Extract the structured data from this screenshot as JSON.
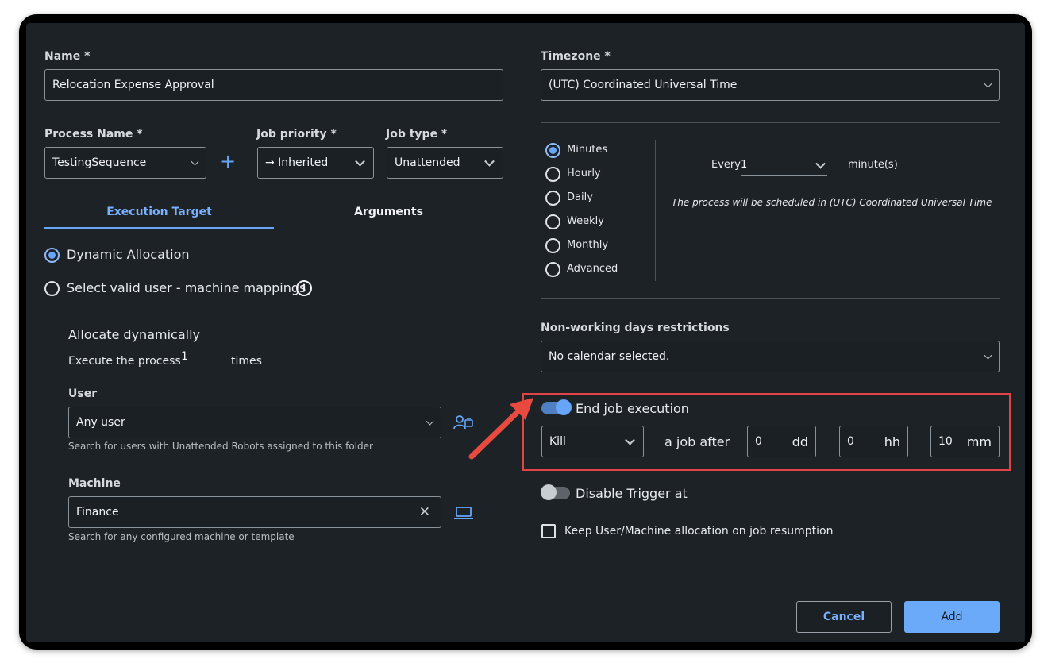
{
  "form": {
    "name_label": "Name *",
    "name_value": "Relocation Expense Approval",
    "process_label": "Process Name *",
    "process_value": "TestingSequence",
    "add_process": "+",
    "priority_label": "Job priority *",
    "priority_value": "→ Inherited",
    "jobtype_label": "Job type *",
    "jobtype_value": "Unattended"
  },
  "tabs": [
    {
      "label": "Execution Target",
      "active": true
    },
    {
      "label": "Arguments",
      "active": false
    }
  ],
  "allocation": {
    "dynamic_label": "Dynamic Allocation",
    "mapping_label": "Select valid user - machine mappings",
    "section_title": "Allocate dynamically",
    "execute_prefix": "Execute the process",
    "execute_count": "1",
    "execute_suffix": "times",
    "user_label": "User",
    "user_value": "Any user",
    "user_hint": "Search for users with Unattended Robots assigned to this folder",
    "machine_label": "Machine",
    "machine_value": "Finance",
    "machine_hint": "Search for any configured machine or template"
  },
  "timezone": {
    "label": "Timezone *",
    "value": "(UTC) Coordinated Universal Time"
  },
  "schedule": {
    "options": [
      "Minutes",
      "Hourly",
      "Daily",
      "Weekly",
      "Monthly",
      "Advanced"
    ],
    "selected": "Minutes",
    "every_label": "Every",
    "every_value": "1",
    "unit": "minute(s)",
    "note": "The process will be scheduled in (UTC) Coordinated Universal Time"
  },
  "calendar": {
    "label": "Non-working days restrictions",
    "value": "No calendar selected."
  },
  "end_job": {
    "label": "End job execution",
    "enabled": true,
    "action": "Kill",
    "after_label": "a job after",
    "days": "0",
    "days_unit": "dd",
    "hours": "0",
    "hours_unit": "hh",
    "minutes": "10",
    "minutes_unit": "mm"
  },
  "disable_trigger": {
    "label": "Disable Trigger at",
    "enabled": false
  },
  "keep_allocation": {
    "label": "Keep User/Machine allocation on job resumption",
    "checked": false
  },
  "buttons": {
    "cancel": "Cancel",
    "add": "Add"
  },
  "colors": {
    "accent": "#66a5f7",
    "background": "#1d2227",
    "highlight": "#e04444"
  }
}
